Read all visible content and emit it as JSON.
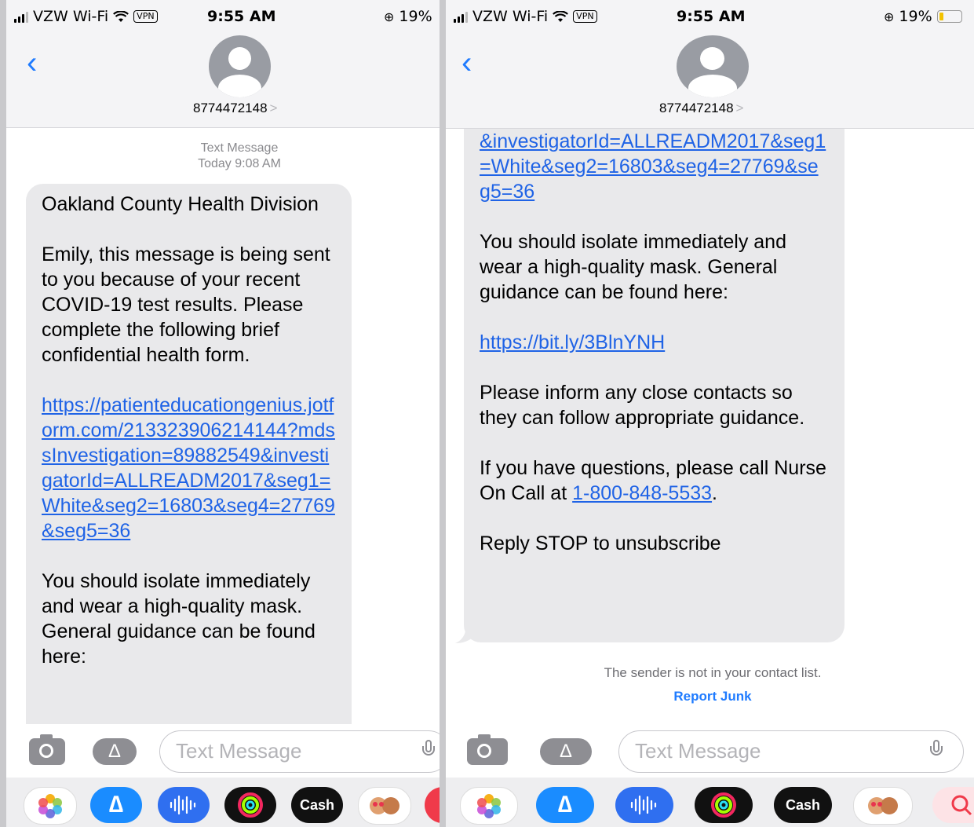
{
  "status_bar": {
    "carrier": "VZW Wi-Fi",
    "vpn": "VPN",
    "time": "9:55 AM",
    "battery": "19%",
    "battery_color": "#f2c200"
  },
  "conversation": {
    "contact": "8774472148",
    "contact_chevron": ">",
    "back_icon": "chevron-left-icon"
  },
  "left": {
    "timestamp_label": "Text Message",
    "timestamp_time": "Today 9:08 AM",
    "message": {
      "sender": "Oakland County Health Division",
      "intro": "Emily, this message is being sent to you because of your recent COVID-19 test results. Please complete the following brief confidential health form.",
      "form_link": "https://patienteducationgenius.jotform.com/213323906214144?mdssInvestigation=89882549&investigatorId=ALLREADM2017&seg1=White&seg2=16803&seg4=27769&seg5=36",
      "isolate": "You should isolate immediately and wear a high-quality mask. General guidance can be found here:"
    }
  },
  "right": {
    "message": {
      "link_tail": "&investigatorId=ALLREADM2017&seg1=White&seg2=16803&seg4=27769&seg5=36",
      "isolate": "You should isolate immediately and wear a high-quality mask. General guidance can be found here:",
      "guidance_link": "https://bit.ly/3BlnYNH",
      "contacts": "Please inform any close contacts so they can follow appropriate guidance.",
      "questions_prefix": "If you have questions, please call Nurse On Call at",
      "phone": "1-800-848-5533",
      "questions_suffix": ".",
      "stop": "Reply STOP to unsubscribe"
    },
    "unknown_sender_note": "The sender is not in your contact list.",
    "report_junk": "Report Junk"
  },
  "composer": {
    "placeholder": "Text Message",
    "camera_icon": "camera-icon",
    "apps_icon": "app-store-icon",
    "mic_icon": "microphone-icon"
  },
  "dock": {
    "apps": [
      {
        "name": "photos-icon",
        "color": "#ffffff"
      },
      {
        "name": "app-store-icon",
        "color": "#1a8cff"
      },
      {
        "name": "audio-message-icon",
        "color": "#2f6ff0"
      },
      {
        "name": "fitness-activity-icon",
        "color": "#111111"
      },
      {
        "name": "apple-cash-icon",
        "label": "Cash",
        "color": "#111111"
      },
      {
        "name": "memoji-icon",
        "color": "#ffffff"
      },
      {
        "name": "search-web-icon",
        "color": "#f03a4a"
      }
    ]
  },
  "colors": {
    "link": "#1f63e6",
    "accent": "#1f7bff",
    "bubble": "#e9e9eb",
    "header_bg": "#f4f4f6"
  }
}
